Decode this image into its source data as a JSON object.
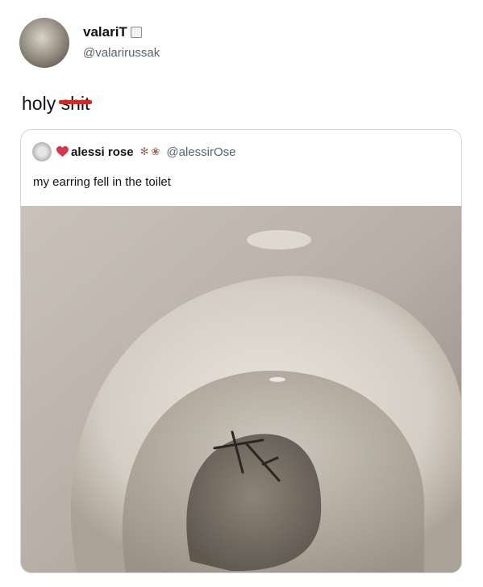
{
  "author": {
    "display_name": "valariT",
    "handle": "@valarirussak"
  },
  "tweet": {
    "text_prefix": "holy ",
    "censored_word": "shit"
  },
  "quoted_tweet": {
    "display_name": "alessi rose",
    "handle": "@alessirOse",
    "text": "my earring fell in the toilet"
  },
  "colors": {
    "censor_mark": "#e0241a",
    "heart": "#d6364b",
    "handle_gray": "#536471"
  }
}
